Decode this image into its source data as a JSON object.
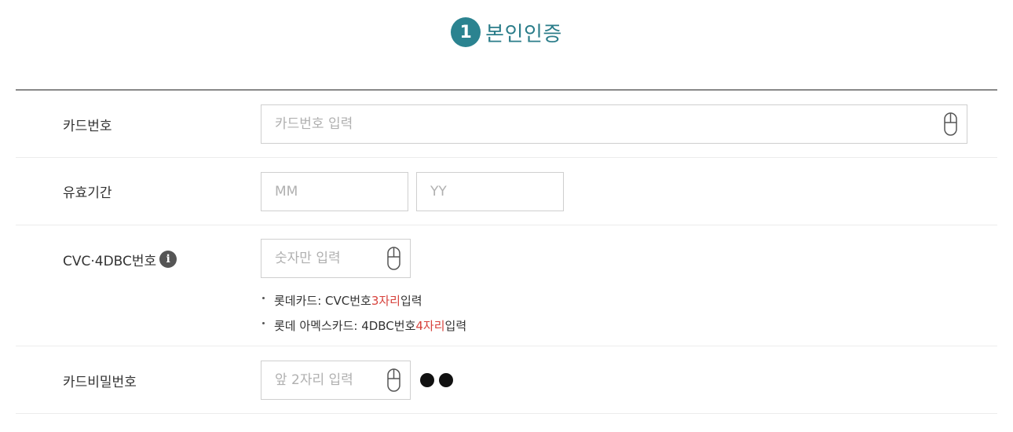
{
  "header": {
    "step": "1",
    "title": "본인인증"
  },
  "card_number": {
    "label": "카드번호",
    "placeholder": "카드번호 입력",
    "icon": "mouse-icon"
  },
  "expiry": {
    "label": "유효기간",
    "month_placeholder": "MM",
    "year_placeholder": "YY"
  },
  "cvc": {
    "label": "CVC·4DBC번호",
    "info_glyph": "i",
    "placeholder": "숫자만 입력",
    "notes": [
      {
        "prefix": "롯데카드: CVC번호 ",
        "highlight": "3자리",
        "suffix": " 입력"
      },
      {
        "prefix": "롯데 아멕스카드: 4DBC번호 ",
        "highlight": "4자리",
        "suffix": " 입력"
      }
    ]
  },
  "password": {
    "label": "카드비밀번호",
    "placeholder": "앞 2자리 입력",
    "masked_digits": 2
  },
  "colors": {
    "accent": "#2b8390",
    "highlight": "#d7423c",
    "border": "#cfcfcf"
  }
}
